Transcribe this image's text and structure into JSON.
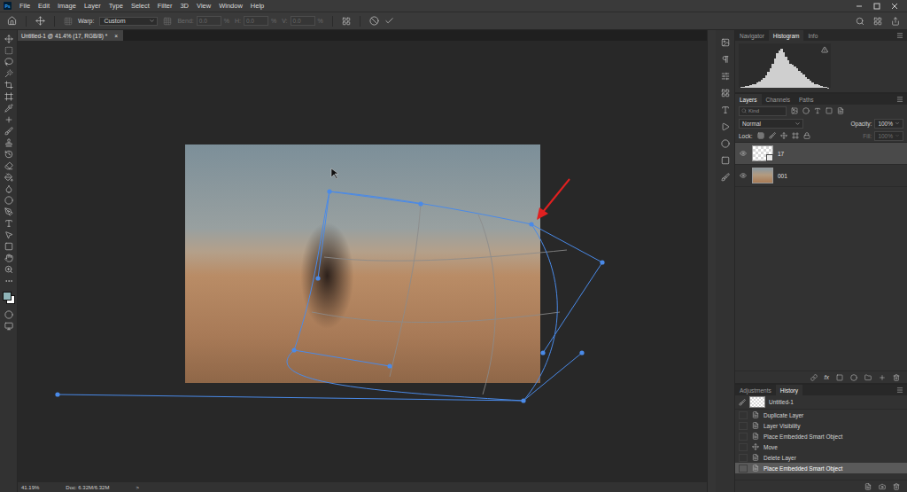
{
  "logo": "Ps",
  "menu": [
    "File",
    "Edit",
    "Image",
    "Layer",
    "Type",
    "Select",
    "Filter",
    "3D",
    "View",
    "Window",
    "Help"
  ],
  "options_bar": {
    "warp_label": "Warp:",
    "warp_value": "Custom",
    "fields": [
      {
        "label": "Bend:",
        "value": "0.0",
        "unit": "%",
        "disabled": true
      },
      {
        "label": "H:",
        "value": "0.0",
        "unit": "%",
        "disabled": true
      },
      {
        "label": "V:",
        "value": "0.0",
        "unit": "%",
        "disabled": true
      }
    ]
  },
  "document_tab": {
    "title": "Untitled-1 @ 41.4% (17, RGB/8) *",
    "close": "×"
  },
  "colors": {
    "foreground": "#8fb4b8",
    "background": "#ffffff"
  },
  "status_bar": {
    "zoom": "41.19%",
    "doc": "Doc: 6.32M/6.32M",
    "arrow": ">"
  },
  "navigator_panel": {
    "tabs": [
      {
        "label": "Navigator",
        "selected": false
      },
      {
        "label": "Histogram",
        "selected": true
      },
      {
        "label": "Info",
        "selected": false
      }
    ],
    "histogram": {
      "warning": true,
      "values": [
        2,
        3,
        4,
        5,
        6,
        8,
        10,
        13,
        16,
        20,
        25,
        32,
        40,
        50,
        62,
        75,
        88,
        96,
        100,
        92,
        80,
        70,
        62,
        58,
        55,
        50,
        44,
        38,
        33,
        28,
        22,
        18,
        14,
        10,
        8,
        6,
        4,
        3,
        2,
        1
      ]
    }
  },
  "layers_panel": {
    "tabs": [
      {
        "label": "Layers",
        "selected": true
      },
      {
        "label": "Channels",
        "selected": false
      },
      {
        "label": "Paths",
        "selected": false
      }
    ],
    "filter_placeholder": "Kind",
    "blend_mode": "Normal",
    "opacity_label": "Opacity:",
    "opacity": "100%",
    "lock_label": "Lock:",
    "fill_label": "Fill:",
    "fill": "100%",
    "fill_disabled": true,
    "layers": [
      {
        "name": "17",
        "kind": "smart",
        "selected": true,
        "visible": true
      },
      {
        "name": "001",
        "kind": "photo",
        "selected": false,
        "visible": true
      }
    ],
    "footer_fx": "fx"
  },
  "history_panel": {
    "tabs": [
      {
        "label": "Adjustments",
        "selected": false
      },
      {
        "label": "History",
        "selected": true
      }
    ],
    "snapshot": {
      "name": "Untitled-1"
    },
    "items": [
      {
        "label": "Duplicate Layer",
        "kind": "action",
        "selected": false
      },
      {
        "label": "Layer Visibility",
        "kind": "action",
        "selected": false
      },
      {
        "label": "Place Embedded Smart Object",
        "kind": "action",
        "selected": false
      },
      {
        "label": "Move",
        "kind": "move",
        "selected": false
      },
      {
        "label": "Delete Layer",
        "kind": "action",
        "selected": false
      },
      {
        "label": "Place Embedded Smart Object",
        "kind": "action",
        "selected": true
      }
    ]
  }
}
